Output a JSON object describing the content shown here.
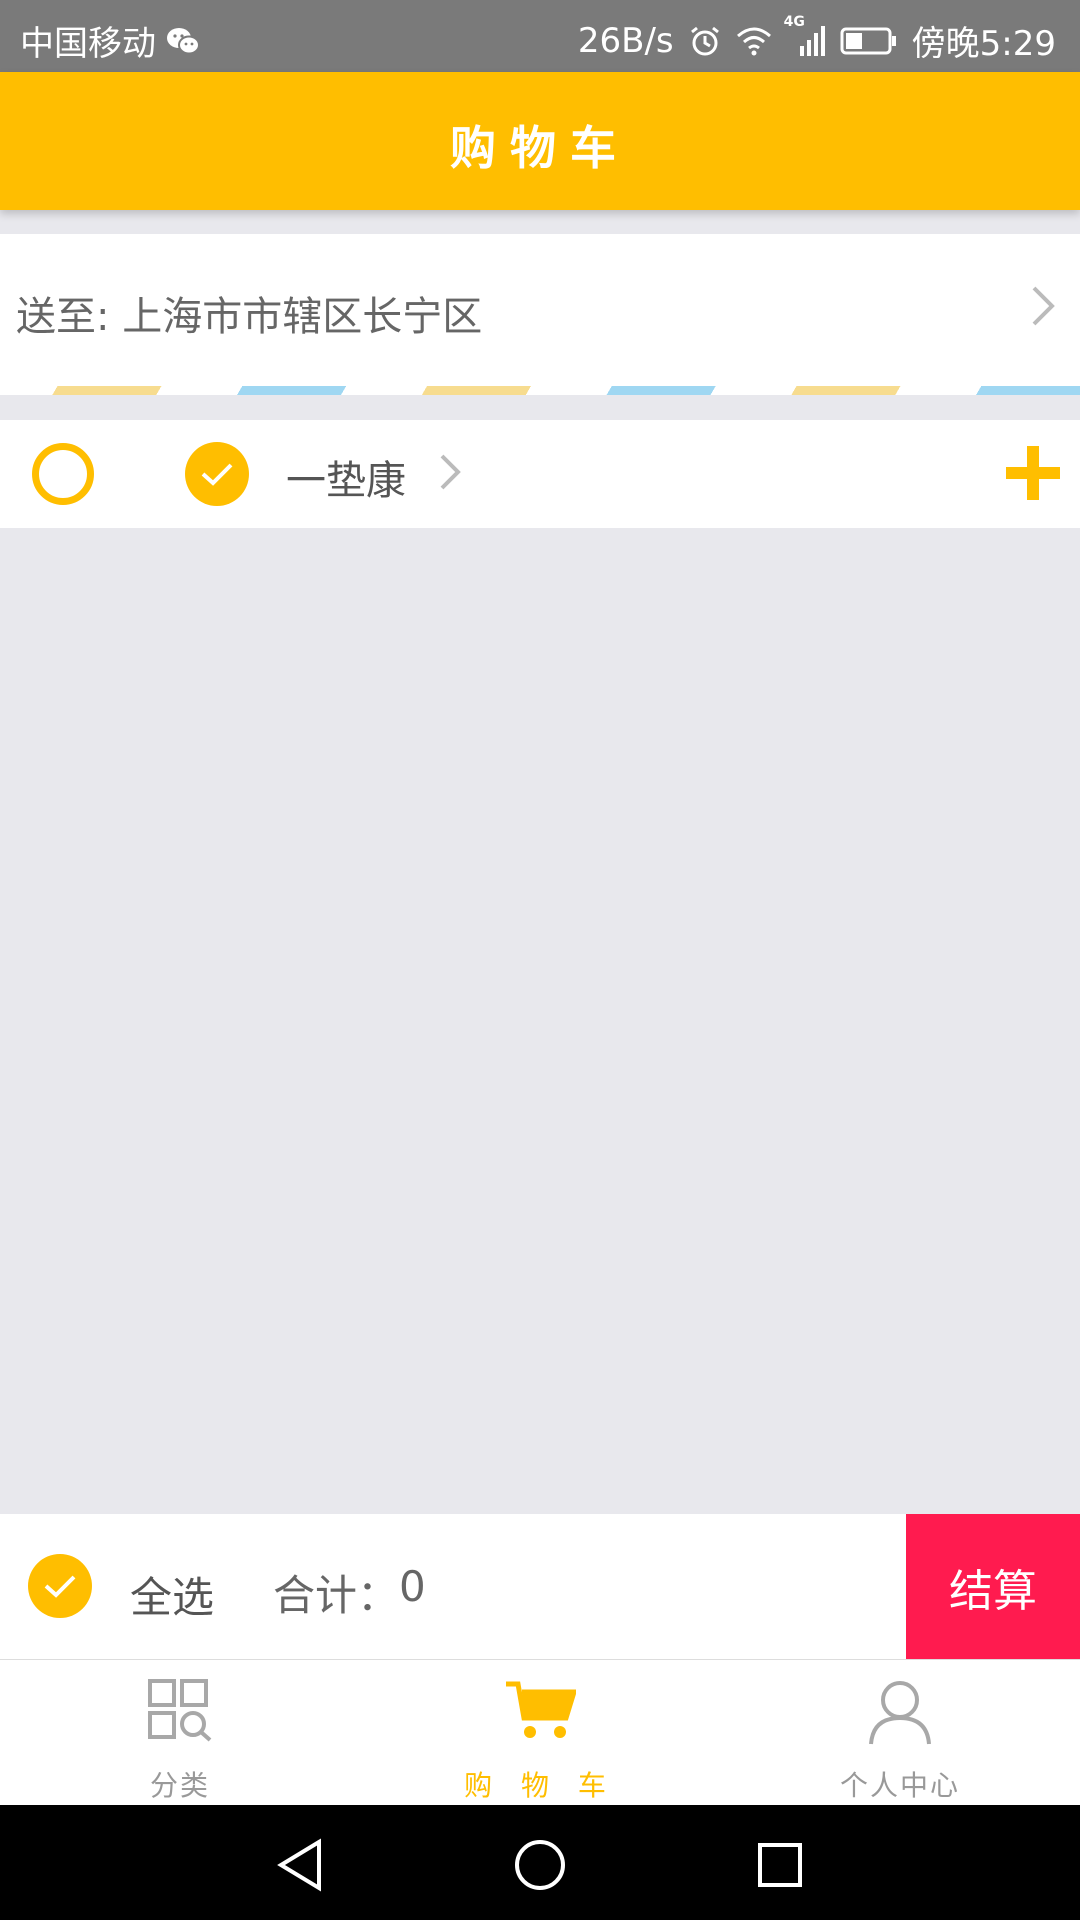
{
  "status_bar": {
    "carrier": "中国移动",
    "speed": "26B/s",
    "network": "4G",
    "time": "傍晚5:29"
  },
  "header": {
    "title": "购物车"
  },
  "address": {
    "text": "送至: 上海市市辖区长宁区"
  },
  "shop": {
    "name": "一垫康",
    "selected": true
  },
  "checkout": {
    "select_all_label": "全选",
    "total_label": "合计：",
    "total_value": "0",
    "settle_label": "结算"
  },
  "tabs": [
    {
      "label": "分类",
      "icon": "category-grid-icon",
      "active": false
    },
    {
      "label": "购 物 车",
      "icon": "cart-icon",
      "active": true
    },
    {
      "label": "个人中心",
      "icon": "person-icon",
      "active": false
    }
  ],
  "colors": {
    "accent": "#ffbe00",
    "settle": "#ff1b4f",
    "status_bar": "#7a7a7a",
    "background": "#e8e8ed"
  }
}
